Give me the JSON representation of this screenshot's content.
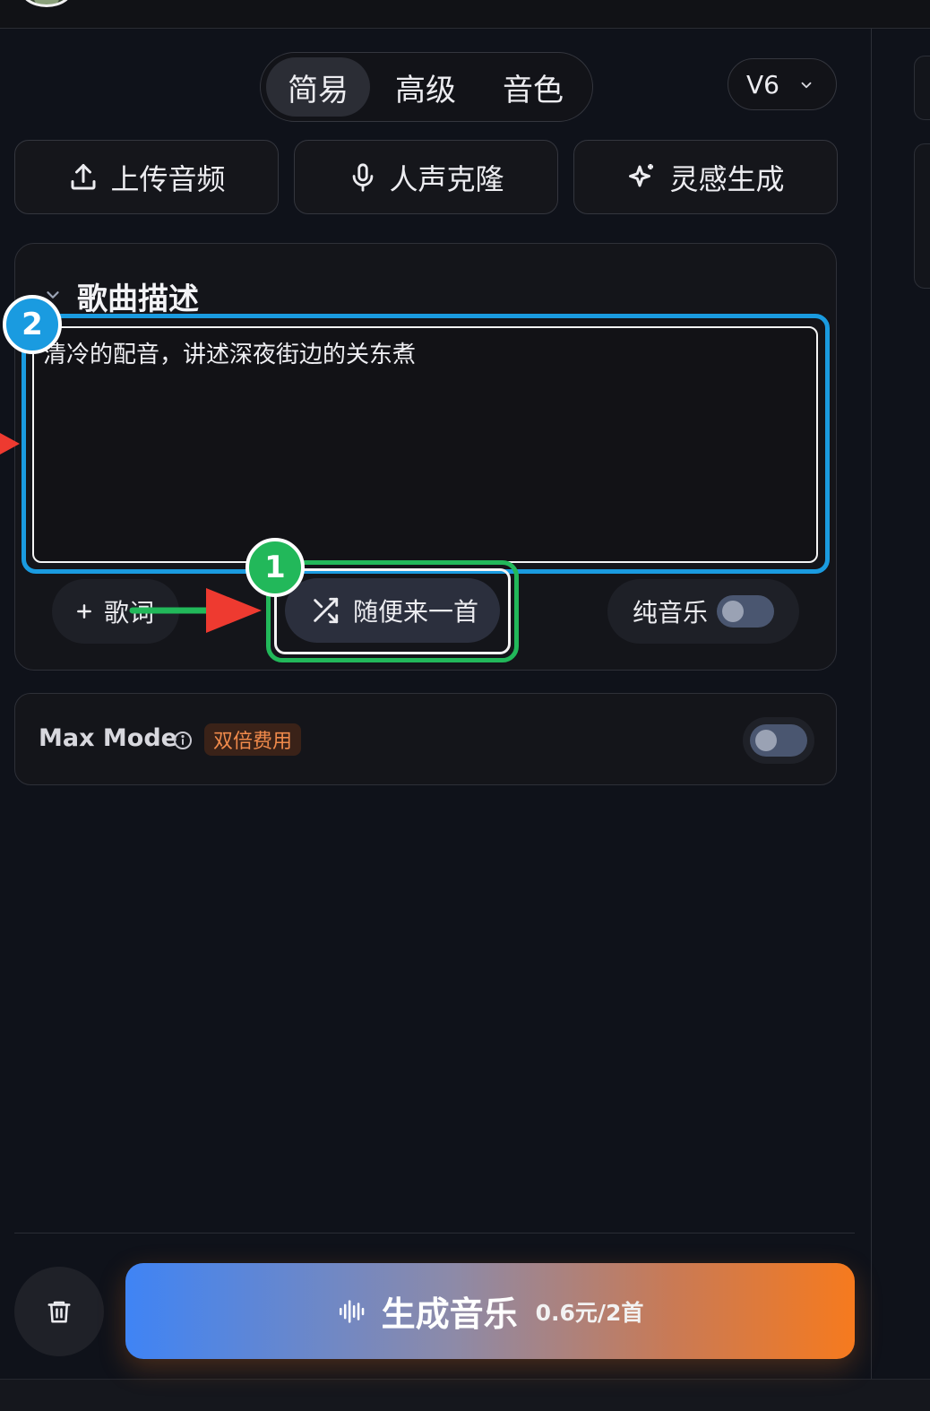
{
  "tabs": [
    {
      "label": "简易",
      "active": true
    },
    {
      "label": "高级",
      "active": false
    },
    {
      "label": "音色",
      "active": false
    }
  ],
  "version": {
    "label": "V6",
    "icon": "chevron-down-icon"
  },
  "actions": {
    "upload": {
      "label": "上传音频",
      "icon": "upload-icon"
    },
    "voice_clone": {
      "label": "人声克隆",
      "icon": "microphone-icon"
    },
    "inspiration": {
      "label": "灵感生成",
      "icon": "sparkle-icon"
    }
  },
  "description_card": {
    "title": "歌曲描述",
    "text": "清冷的配音，讲述深夜街边的关东煮"
  },
  "options": {
    "lyrics_label": "歌词",
    "random_label": "随便来一首",
    "pure_music_label": "纯音乐",
    "pure_music_on": false
  },
  "max_mode": {
    "label": "Max Mode",
    "badge": "双倍费用",
    "enabled": false
  },
  "generate": {
    "label": "生成音乐",
    "price": "0.6元/2首"
  },
  "annotations": {
    "badge_1": "1",
    "badge_2": "2",
    "colors": {
      "blue": "#1a9be0",
      "green": "#22b85a",
      "red": "#ee3a30"
    }
  }
}
